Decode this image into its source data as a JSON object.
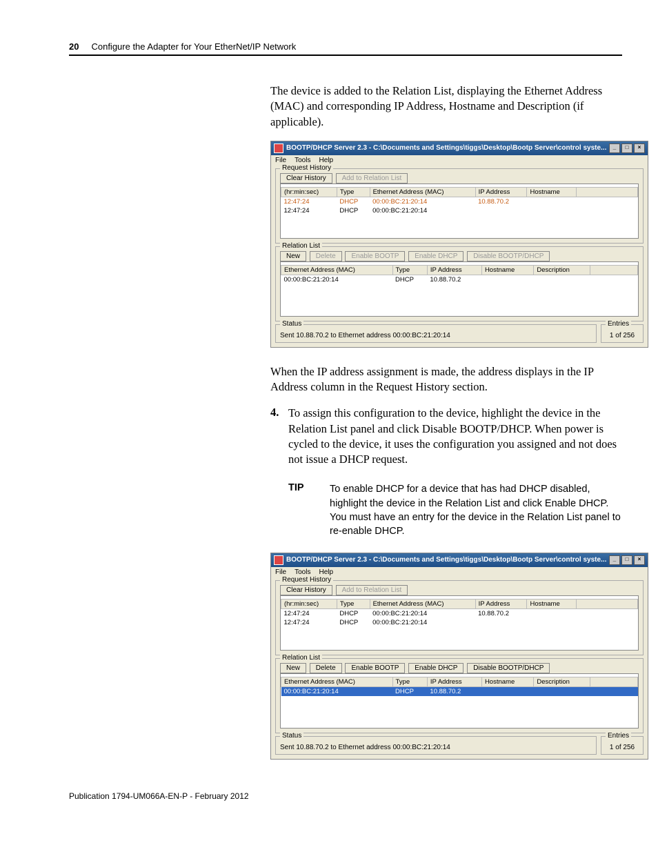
{
  "header": {
    "page_number": "20",
    "chapter": "Configure the Adapter for Your EtherNet/IP Network"
  },
  "para_intro": "The device is added to the Relation List, displaying the Ethernet Address (MAC) and corresponding IP Address, Hostname and Description (if applicable).",
  "para_after1": "When the IP address assignment is made, the address displays in the IP Address column in the Request History section.",
  "step4_num": "4.",
  "step4_text": "To assign this configuration to the device, highlight the device in the Relation List panel and click Disable BOOTP/DHCP. When power is cycled to the device, it uses the configuration you assigned and not does not issue a DHCP request.",
  "tip_label": "TIP",
  "tip_text": "To enable DHCP for a device that has had DHCP disabled, highlight the device in the Relation List and click Enable DHCP. You must have an entry for the device in the Relation List panel to re-enable DHCP.",
  "window": {
    "title": "BOOTP/DHCP Server 2.3 - C:\\Documents and Settings\\tiggs\\Desktop\\Bootp Server\\control syste...",
    "menu": {
      "file": "File",
      "tools": "Tools",
      "help": "Help"
    },
    "req_history_label": "Request History",
    "btn_clear": "Clear History",
    "btn_add": "Add to Relation List",
    "req_cols": {
      "time": "(hr:min:sec)",
      "type": "Type",
      "mac": "Ethernet Address (MAC)",
      "ip": "IP Address",
      "host": "Hostname"
    },
    "req_rows": [
      {
        "time": "12:47:24",
        "type": "DHCP",
        "mac": "00:00:BC:21:20:14",
        "ip": "10.88.70.2",
        "host": ""
      },
      {
        "time": "12:47:24",
        "type": "DHCP",
        "mac": "00:00:BC:21:20:14",
        "ip": "",
        "host": ""
      }
    ],
    "rel_label": "Relation List",
    "btn_new": "New",
    "btn_delete": "Delete",
    "btn_enable_bootp": "Enable BOOTP",
    "btn_enable_dhcp": "Enable DHCP",
    "btn_disable": "Disable BOOTP/DHCP",
    "rel_cols": {
      "mac": "Ethernet Address (MAC)",
      "type": "Type",
      "ip": "IP Address",
      "host": "Hostname",
      "desc": "Description"
    },
    "rel_rows": [
      {
        "mac": "00:00:BC:21:20:14",
        "type": "DHCP",
        "ip": "10.88.70.2",
        "host": "",
        "desc": ""
      }
    ],
    "status_label": "Status",
    "status_text": "Sent 10.88.70.2 to Ethernet address 00:00:BC:21:20:14",
    "entries_label": "Entries",
    "entries_text": "1 of 256"
  },
  "footer": "Publication 1794-UM066A-EN-P - February 2012"
}
